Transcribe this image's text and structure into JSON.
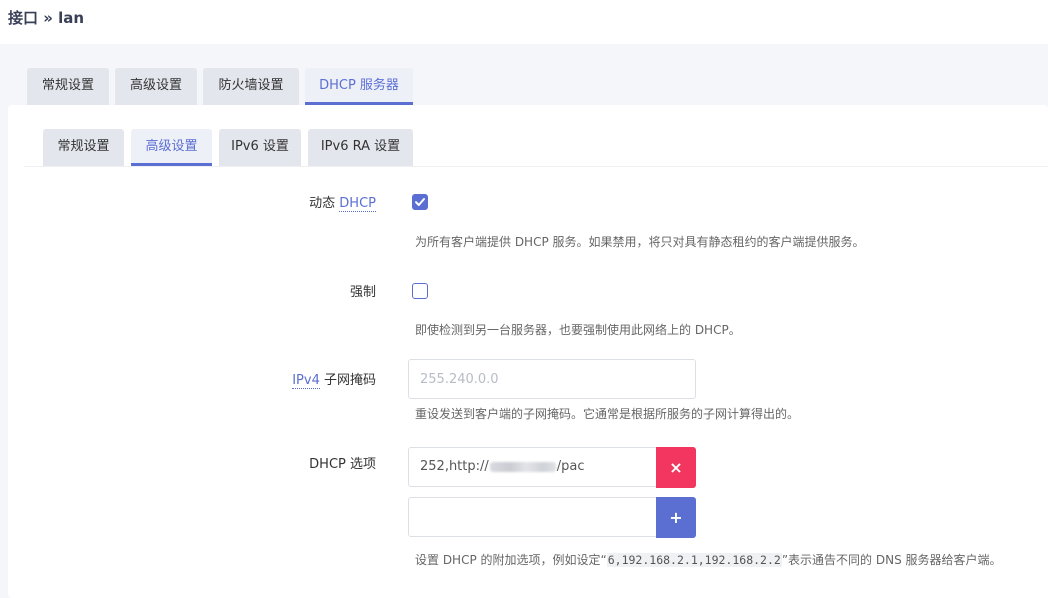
{
  "breadcrumb": "接口 » lan",
  "main_tabs": [
    {
      "label": "常规设置",
      "active": false
    },
    {
      "label": "高级设置",
      "active": false
    },
    {
      "label": "防火墙设置",
      "active": false
    },
    {
      "label": "DHCP 服务器",
      "active": true
    }
  ],
  "sub_tabs": [
    {
      "label": "常规设置",
      "active": false
    },
    {
      "label": "高级设置",
      "active": true
    },
    {
      "label": "IPv6 设置",
      "active": false
    },
    {
      "label": "IPv6 RA 设置",
      "active": false
    }
  ],
  "fields": {
    "dynamic_dhcp": {
      "label_prefix": "动态 ",
      "label_abbr": "DHCP",
      "checked": true,
      "description": "为所有客户端提供 DHCP 服务。如果禁用，将只对具有静态租约的客户端提供服务。"
    },
    "force": {
      "label": "强制",
      "checked": false,
      "description": "即使检测到另一台服务器，也要强制使用此网络上的 DHCP。"
    },
    "netmask": {
      "label_abbr": "IPv4",
      "label_suffix": " 子网掩码",
      "value": "",
      "placeholder": "255.240.0.0",
      "description": "重设发送到客户端的子网掩码。它通常是根据所服务的子网计算得出的。"
    },
    "dhcp_options": {
      "label": "DHCP 选项",
      "entries": [
        {
          "value_prefix": "252,http://",
          "value_suffix": "/pac"
        }
      ],
      "new_value": "",
      "remove_label": "×",
      "add_label": "+",
      "description_prefix": "设置 DHCP 的附加选项，例如设定“",
      "description_code": "6,192.168.2.1,192.168.2.2",
      "description_suffix": "”表示通告不同的 DNS 服务器给客户端。"
    }
  },
  "colors": {
    "accent": "#5b6fd3",
    "danger": "#f2365f",
    "tab_bg": "#e3e6ed",
    "page_bg": "#f5f6fa"
  }
}
